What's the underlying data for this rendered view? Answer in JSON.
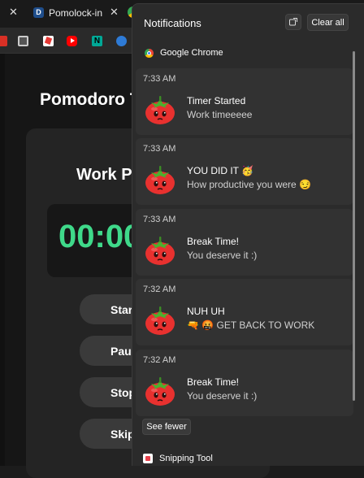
{
  "browser": {
    "tabs": [
      {
        "label": "Pomolock-in",
        "favicon": "D"
      }
    ],
    "page": {
      "title": "Pomodoro T",
      "mode": "Work P",
      "timer": "00:00",
      "buttons": [
        "Star",
        "Paus",
        "Stop",
        "Skip"
      ]
    },
    "accent": "#3fd98a"
  },
  "notification_center": {
    "title": "Notifications",
    "clear_all": "Clear all",
    "app": "Google Chrome",
    "notifications": [
      {
        "time": "7:33 AM",
        "title": "Timer Started",
        "body": "Work timeeeee"
      },
      {
        "time": "7:33 AM",
        "title": "YOU DID IT 🥳",
        "body": "How productive you were 😏"
      },
      {
        "time": "7:33 AM",
        "title": "Break Time!",
        "body": "You deserve it :)"
      },
      {
        "time": "7:32 AM",
        "title": "NUH UH",
        "body": "🔫 🤬 GET BACK TO WORK"
      },
      {
        "time": "7:32 AM",
        "title": "Break Time!",
        "body": "You deserve it :)"
      }
    ],
    "see_fewer": "See fewer",
    "next_app": "Snipping Tool"
  }
}
